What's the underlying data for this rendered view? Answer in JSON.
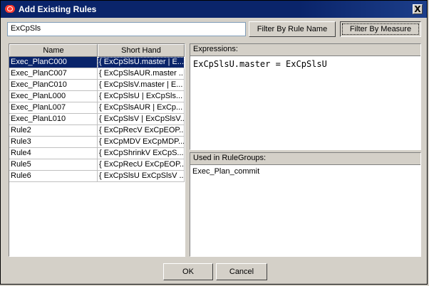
{
  "window": {
    "title": "Add Existing Rules",
    "close_label": "X"
  },
  "search": {
    "value": "ExCpSls"
  },
  "filters": {
    "by_rule_name": "Filter By Rule Name",
    "by_measure": "Filter By Measure"
  },
  "table": {
    "columns": [
      "Name",
      "Short Hand"
    ],
    "rows": [
      {
        "name": "Exec_PlanC000",
        "short": "{ ExCpSlsU.master | E..."
      },
      {
        "name": "Exec_PlanC007",
        "short": "{ ExCpSlsAUR.master ..."
      },
      {
        "name": "Exec_PlanC010",
        "short": "{ ExCpSlsV.master | E..."
      },
      {
        "name": "Exec_PlanL000",
        "short": "{ ExCpSlsU | ExCpSls..."
      },
      {
        "name": "Exec_PlanL007",
        "short": "{ ExCpSlsAUR | ExCp..."
      },
      {
        "name": "Exec_PlanL010",
        "short": "{ ExCpSlsV | ExCpSlsV..."
      },
      {
        "name": "Rule2",
        "short": "{ ExCpRecV ExCpEOP..."
      },
      {
        "name": "Rule3",
        "short": "{ ExCpMDV ExCpMDP..."
      },
      {
        "name": "Rule4",
        "short": "{ ExCpShrinkV ExCpS..."
      },
      {
        "name": "Rule5",
        "short": "{ ExCpRecU ExCpEOP..."
      },
      {
        "name": "Rule6",
        "short": "{ ExCpSlsU ExCpSlsV ..."
      }
    ]
  },
  "expressions": {
    "header": "Expressions:",
    "text": "ExCpSlsU.master = ExCpSlsU"
  },
  "used_in": {
    "header": "Used in RuleGroups:",
    "items": [
      "Exec_Plan_commit"
    ]
  },
  "footer": {
    "ok": "OK",
    "cancel": "Cancel"
  },
  "colors": {
    "titlebar": "#0a246a",
    "selection": "#0a246a",
    "face": "#d4d0c8"
  }
}
